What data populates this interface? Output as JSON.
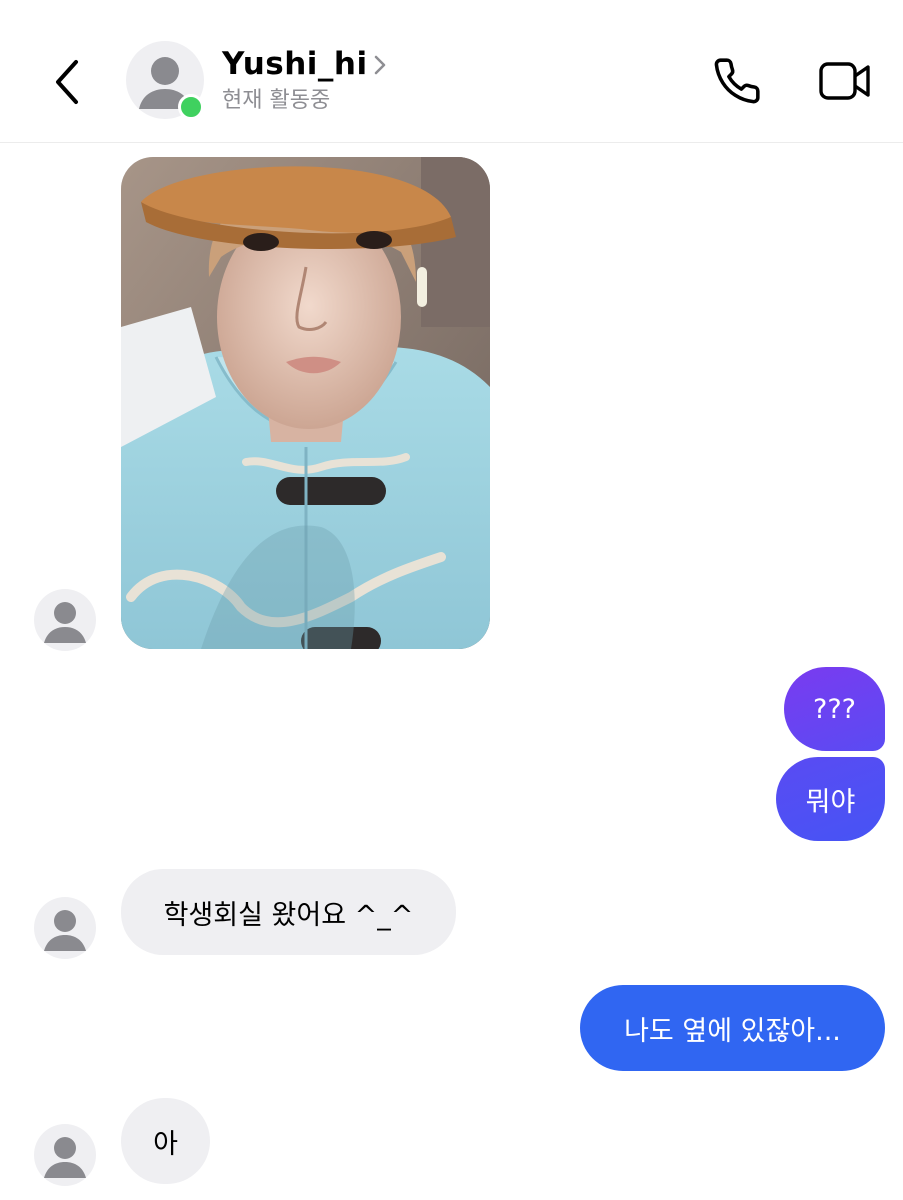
{
  "header": {
    "contact_name": "Yushi_hi",
    "status": "현재 활동중",
    "icons": {
      "back": "chevron-left-icon",
      "name_chevron": "chevron-right-icon",
      "call": "phone-icon",
      "video": "video-camera-icon"
    },
    "online_color": "#3fd15f"
  },
  "messages": [
    {
      "from": "them",
      "type": "photo"
    },
    {
      "from": "me",
      "text": "???"
    },
    {
      "from": "me",
      "text": "뭐야"
    },
    {
      "from": "them",
      "text": "학생회실 왔어요 ^_^"
    },
    {
      "from": "me",
      "text": "나도 옆에 있잖아..."
    },
    {
      "from": "them",
      "text": "아"
    }
  ],
  "colors": {
    "outgoing_gradient_start": "#7d37f0",
    "outgoing_gradient_end": "#3b5bf5",
    "outgoing_solid": "#3066f2",
    "incoming": "#efeff2"
  }
}
